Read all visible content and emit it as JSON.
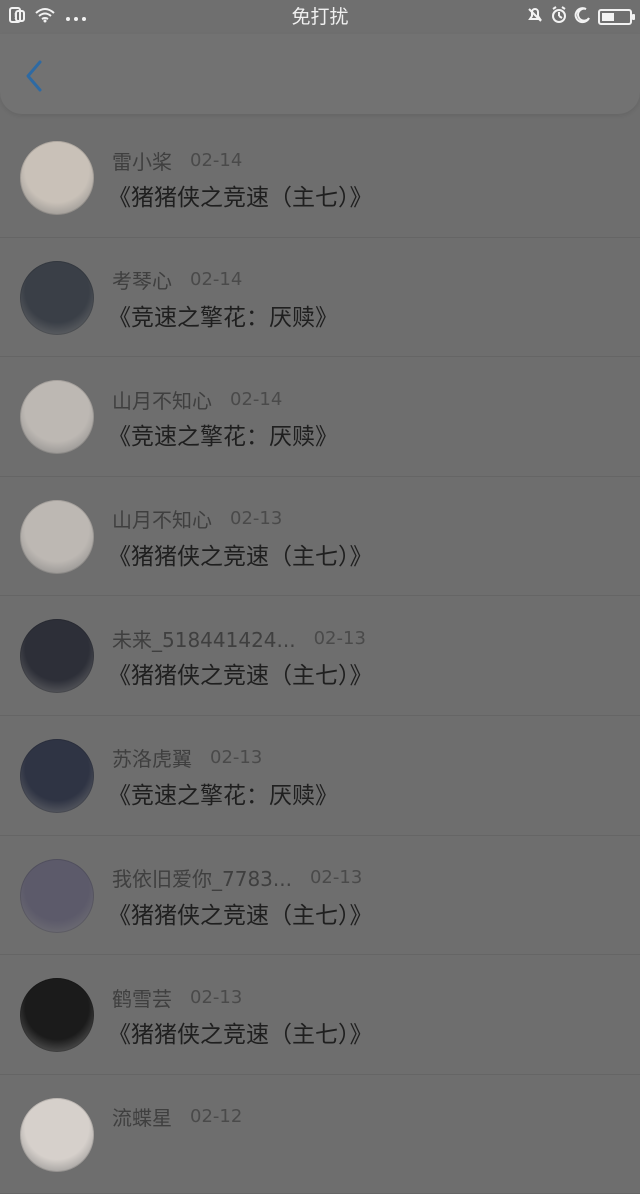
{
  "status_bar": {
    "center_text": "免打扰"
  },
  "nav": {
    "back_icon": "chevron-left-icon"
  },
  "items": [
    {
      "user": "雷小桨",
      "date": "02-14",
      "title": "《猪猪侠之竞速（主七）》",
      "avatar_color": "#c9c1b8"
    },
    {
      "user": "考琴心",
      "date": "02-14",
      "title": "《竞速之擎花：厌赎》",
      "avatar_color": "#3a3f47"
    },
    {
      "user": "山月不知心",
      "date": "02-14",
      "title": "《竞速之擎花：厌赎》",
      "avatar_color": "#bdb8b3"
    },
    {
      "user": "山月不知心",
      "date": "02-13",
      "title": "《猪猪侠之竞速（主七）》",
      "avatar_color": "#bdb8b3"
    },
    {
      "user": "未来_518441424...",
      "date": "02-13",
      "title": "《猪猪侠之竞速（主七）》",
      "avatar_color": "#2d2f38"
    },
    {
      "user": "苏洛虎翼",
      "date": "02-13",
      "title": "《竞速之擎花：厌赎》",
      "avatar_color": "#2f3444"
    },
    {
      "user": "我依旧爱你_7783...",
      "date": "02-13",
      "title": "《猪猪侠之竞速（主七）》",
      "avatar_color": "#5c5a6a"
    },
    {
      "user": "鹤雪芸",
      "date": "02-13",
      "title": "《猪猪侠之竞速（主七）》",
      "avatar_color": "#1b1b1b"
    },
    {
      "user": "流蝶星",
      "date": "02-12",
      "title": "",
      "avatar_color": "#d6d0cb"
    }
  ]
}
